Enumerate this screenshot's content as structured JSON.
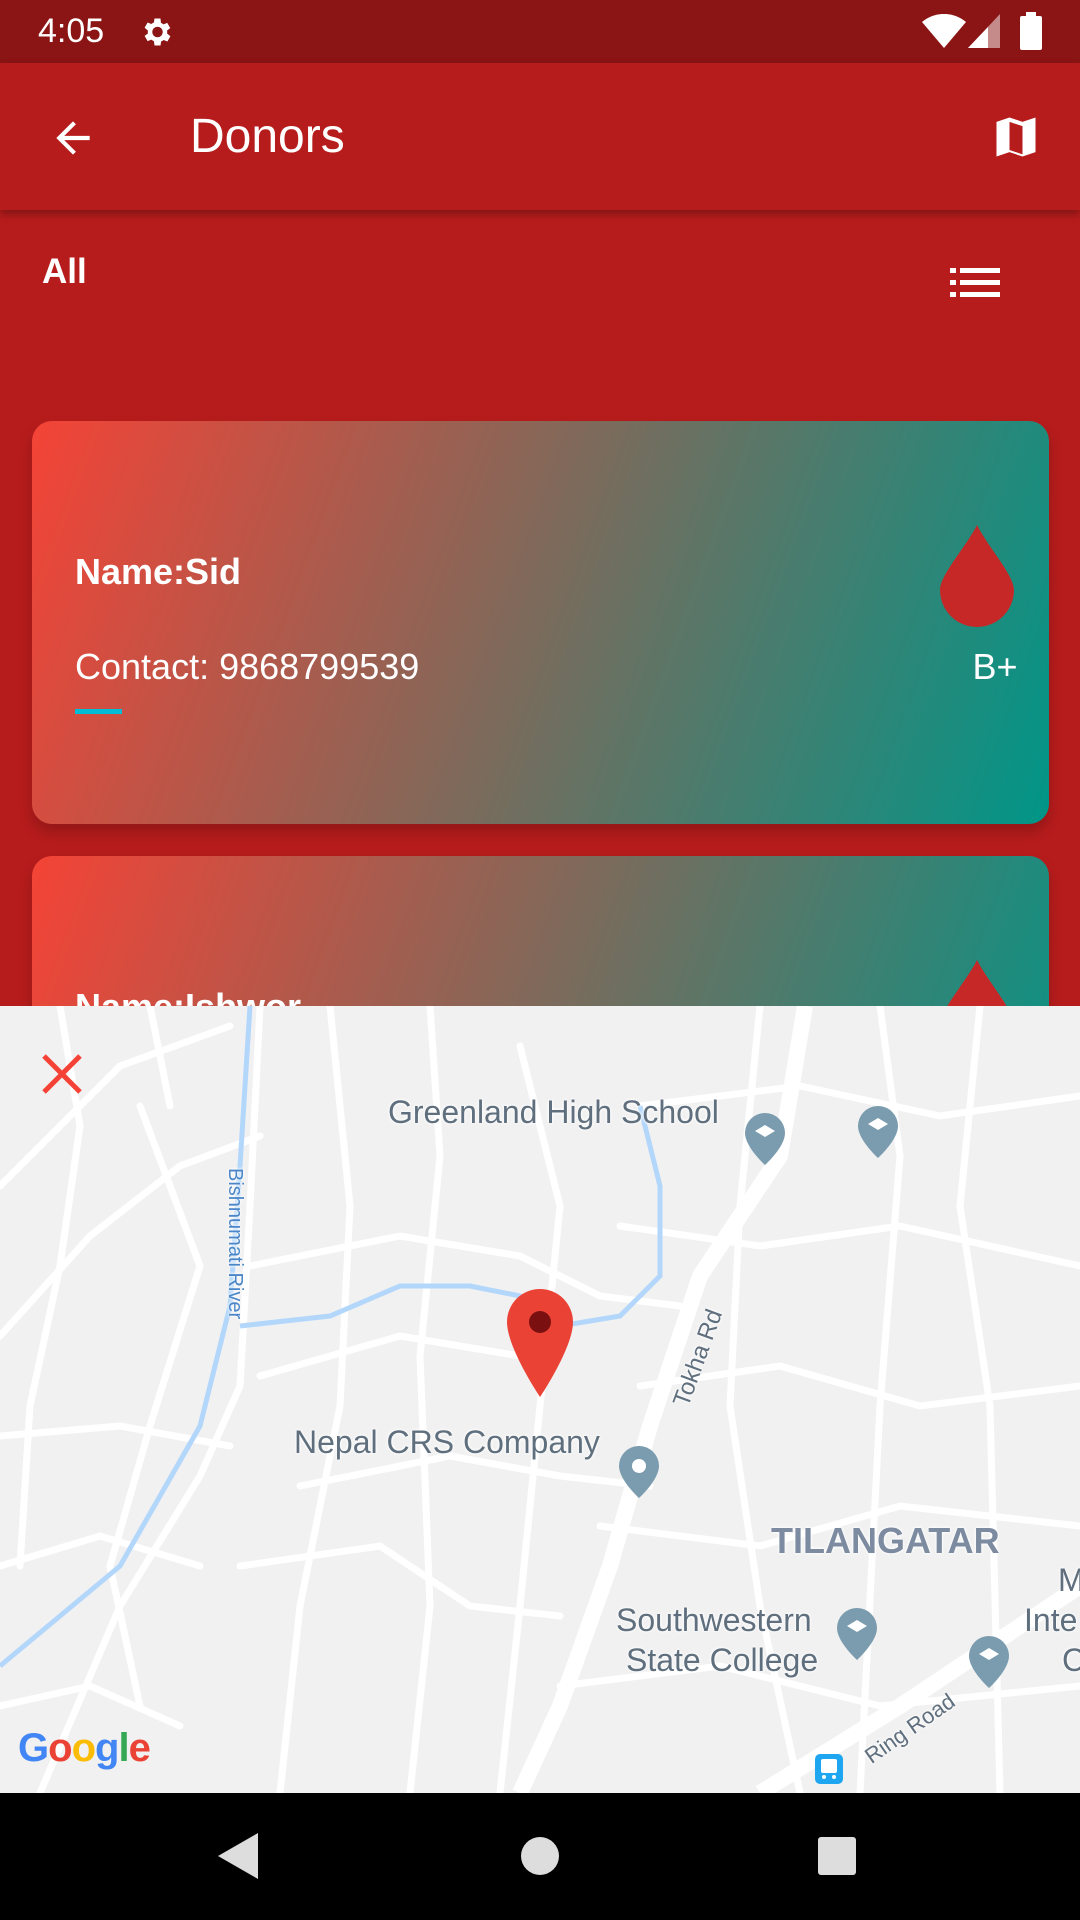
{
  "status_bar": {
    "time": "4:05",
    "icons": [
      "settings-icon",
      "wifi-icon",
      "signal-icon",
      "battery-icon"
    ]
  },
  "app_bar": {
    "title": "Donors",
    "back_icon": "arrow-back-icon",
    "map_icon": "map-icon"
  },
  "filter": {
    "label": "All",
    "list_icon": "list-icon"
  },
  "donors": [
    {
      "name": "Name:Sid",
      "contact": "Contact: 9868799539",
      "blood_group": "B+"
    },
    {
      "name": "Name:Ishwor"
    }
  ],
  "map": {
    "close_icon": "close-icon",
    "labels": {
      "school1": "Greenland High School",
      "river": "Bishnumati River",
      "road1": "Tokha Rd",
      "company": "Nepal CRS Company",
      "area": "TILANGATAR",
      "college1": "Southwestern",
      "college2": "State College",
      "edge1": "M",
      "edge2": "Inte",
      "edge3": "C",
      "road2": "Ring Road"
    },
    "attribution": "Google"
  },
  "colors": {
    "primary": "#b71c1c",
    "status": "#8b1414",
    "card_start": "#f44336",
    "card_end": "#009688",
    "accent": "#00bcd4",
    "drop": "#c62828",
    "marker": "#ea4335"
  }
}
